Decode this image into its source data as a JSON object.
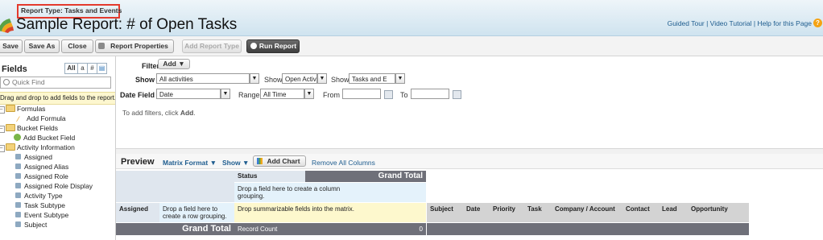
{
  "header": {
    "report_type": "Report Type: Tasks and Events",
    "title": "Sample Report: # of Open Tasks",
    "help_links": "Guided Tour | Video Tutorial | Help for this Page",
    "help_icon": "?"
  },
  "toolbar": {
    "save": "Save",
    "save_as": "Save As",
    "close": "Close",
    "report_properties": "Report Properties",
    "add_report_type": "Add Report Type",
    "run_report": "Run Report"
  },
  "fields_panel": {
    "title": "Fields",
    "toggle_all": "All",
    "toggle_a": "a",
    "toggle_hash": "#",
    "toggle_date": "▤",
    "search_placeholder": "Quick Find",
    "drag_hint": "Drag and drop to add fields to the report.",
    "tree": {
      "formulas": "Formulas",
      "add_formula": "Add Formula",
      "bucket_fields": "Bucket Fields",
      "add_bucket_field": "Add Bucket Field",
      "activity_information": "Activity Information",
      "items": [
        "Assigned",
        "Assigned Alias",
        "Assigned Role",
        "Assigned Role Display",
        "Activity Type",
        "Task Subtype",
        "Event Subtype",
        "Subject"
      ]
    }
  },
  "filters": {
    "label": "Filters",
    "add_button": "Add",
    "show_label": "Show",
    "show_value": "All activities",
    "show2_label": "Show",
    "show2_value": "Open Activit",
    "show3_label": "Show",
    "show3_value": "Tasks and E",
    "date_field_label": "Date Field",
    "date_field_value": "Date",
    "range_label": "Range",
    "range_value": "All Time",
    "from_label": "From",
    "to_label": "To",
    "hint_prefix": "To add filters, click ",
    "hint_bold": "Add",
    "hint_suffix": "."
  },
  "preview": {
    "title": "Preview",
    "format": "Matrix Format",
    "show": "Show",
    "add_chart": "Add Chart",
    "remove_columns": "Remove All Columns",
    "status": "Status",
    "grand_total_col": "Grand Total",
    "drop_column": "Drop a field here to create a column grouping.",
    "assigned": "Assigned",
    "drop_row": "Drop a field here to create a row grouping.",
    "drop_summary": "Drop summarizable fields into the matrix.",
    "grand_total_row": "Grand Total",
    "record_count": "Record Count",
    "record_count_value": "0",
    "columns": [
      "Subject",
      "Date",
      "Priority",
      "Task",
      "Company / Account",
      "Contact",
      "Lead",
      "Opportunity"
    ]
  }
}
